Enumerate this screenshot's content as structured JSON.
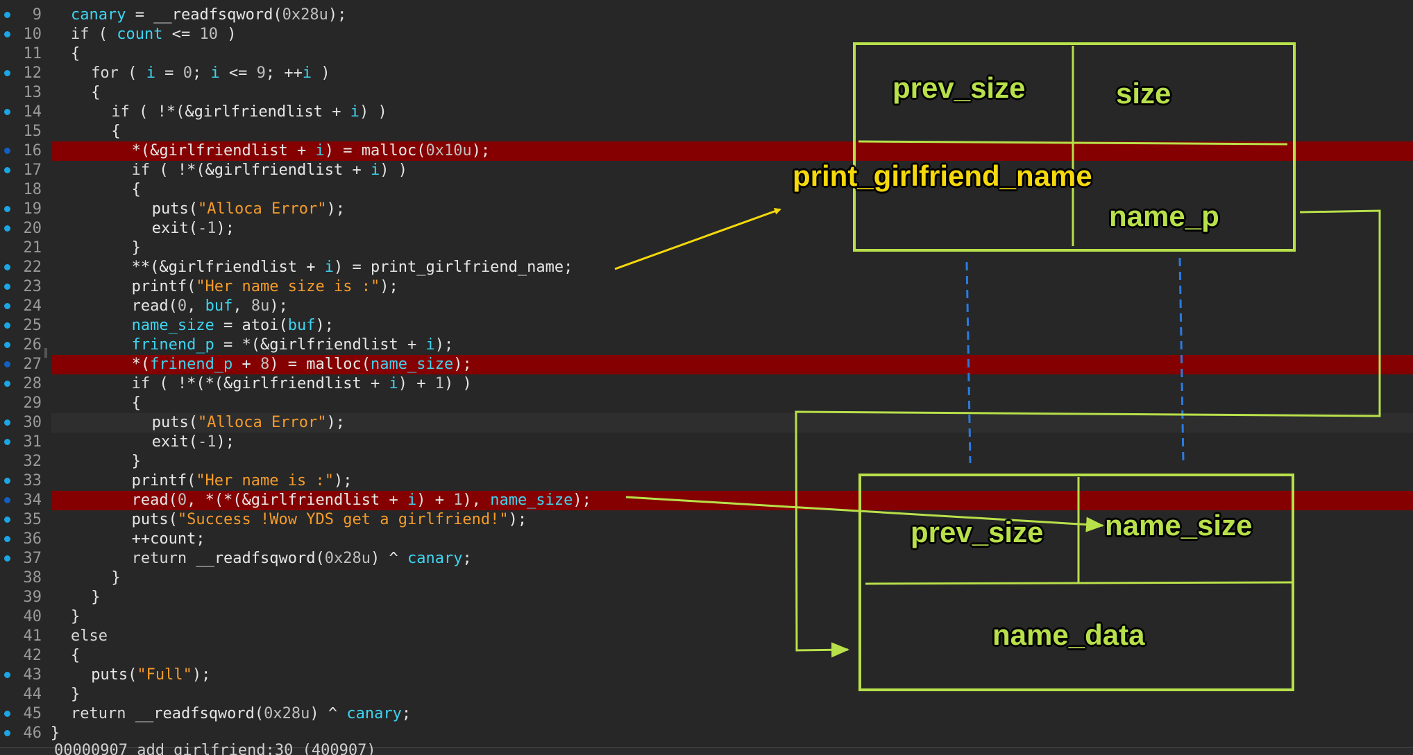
{
  "editor": {
    "lines": [
      {
        "n": "9",
        "dot": "light",
        "hl": false,
        "indent": 1,
        "tokens": [
          [
            "var",
            "canary"
          ],
          [
            "plain",
            " = __readfsqword("
          ],
          [
            "num",
            "0x28u"
          ],
          [
            "plain",
            ");"
          ]
        ]
      },
      {
        "n": "10",
        "dot": "light",
        "hl": false,
        "indent": 1,
        "tokens": [
          [
            "kw",
            "if"
          ],
          [
            "plain",
            " ( "
          ],
          [
            "var",
            "count"
          ],
          [
            "plain",
            " <= "
          ],
          [
            "num",
            "10"
          ],
          [
            "plain",
            " )"
          ]
        ]
      },
      {
        "n": "11",
        "dot": "none",
        "hl": false,
        "indent": 1,
        "tokens": [
          [
            "plain",
            "{"
          ]
        ]
      },
      {
        "n": "12",
        "dot": "light",
        "hl": false,
        "indent": 2,
        "tokens": [
          [
            "kw",
            "for"
          ],
          [
            "plain",
            " ( "
          ],
          [
            "var",
            "i"
          ],
          [
            "plain",
            " = "
          ],
          [
            "num",
            "0"
          ],
          [
            "plain",
            "; "
          ],
          [
            "var",
            "i"
          ],
          [
            "plain",
            " <= "
          ],
          [
            "num",
            "9"
          ],
          [
            "plain",
            "; ++"
          ],
          [
            "var",
            "i"
          ],
          [
            "plain",
            " )"
          ]
        ]
      },
      {
        "n": "13",
        "dot": "none",
        "hl": false,
        "indent": 2,
        "tokens": [
          [
            "plain",
            "{"
          ]
        ]
      },
      {
        "n": "14",
        "dot": "light",
        "hl": false,
        "indent": 3,
        "tokens": [
          [
            "kw",
            "if"
          ],
          [
            "plain",
            " ( !*(&girlfriendlist + "
          ],
          [
            "var",
            "i"
          ],
          [
            "plain",
            ") )"
          ]
        ]
      },
      {
        "n": "15",
        "dot": "none",
        "hl": false,
        "indent": 3,
        "tokens": [
          [
            "plain",
            "{"
          ]
        ]
      },
      {
        "n": "16",
        "dot": "dark",
        "hl": true,
        "indent": 4,
        "tokens": [
          [
            "plain",
            "*(&girlfriendlist + "
          ],
          [
            "var",
            "i"
          ],
          [
            "plain",
            ") = malloc("
          ],
          [
            "num",
            "0x10u"
          ],
          [
            "plain",
            ");"
          ]
        ]
      },
      {
        "n": "17",
        "dot": "light",
        "hl": false,
        "indent": 4,
        "tokens": [
          [
            "kw",
            "if"
          ],
          [
            "plain",
            " ( !*(&girlfriendlist + "
          ],
          [
            "var",
            "i"
          ],
          [
            "plain",
            ") )"
          ]
        ]
      },
      {
        "n": "18",
        "dot": "none",
        "hl": false,
        "indent": 4,
        "tokens": [
          [
            "plain",
            "{"
          ]
        ]
      },
      {
        "n": "19",
        "dot": "light",
        "hl": false,
        "indent": 5,
        "tokens": [
          [
            "plain",
            "puts("
          ],
          [
            "str",
            "\"Alloca Error\""
          ],
          [
            "plain",
            ");"
          ]
        ]
      },
      {
        "n": "20",
        "dot": "light",
        "hl": false,
        "indent": 5,
        "tokens": [
          [
            "plain",
            "exit("
          ],
          [
            "num",
            "-1"
          ],
          [
            "plain",
            ");"
          ]
        ]
      },
      {
        "n": "21",
        "dot": "none",
        "hl": false,
        "indent": 4,
        "tokens": [
          [
            "plain",
            "}"
          ]
        ]
      },
      {
        "n": "22",
        "dot": "light",
        "hl": false,
        "indent": 4,
        "tokens": [
          [
            "plain",
            "**(&girlfriendlist + "
          ],
          [
            "var",
            "i"
          ],
          [
            "plain",
            ") = print_girlfriend_name;"
          ]
        ]
      },
      {
        "n": "23",
        "dot": "light",
        "hl": false,
        "indent": 4,
        "tokens": [
          [
            "plain",
            "printf("
          ],
          [
            "str",
            "\"Her name size is :\""
          ],
          [
            "plain",
            ");"
          ]
        ]
      },
      {
        "n": "24",
        "dot": "light",
        "hl": false,
        "indent": 4,
        "tokens": [
          [
            "plain",
            "read("
          ],
          [
            "num",
            "0"
          ],
          [
            "plain",
            ", "
          ],
          [
            "var",
            "buf"
          ],
          [
            "plain",
            ", "
          ],
          [
            "num",
            "8u"
          ],
          [
            "plain",
            ");"
          ]
        ]
      },
      {
        "n": "25",
        "dot": "light",
        "hl": false,
        "indent": 4,
        "tokens": [
          [
            "var",
            "name_size"
          ],
          [
            "plain",
            " = atoi("
          ],
          [
            "var",
            "buf"
          ],
          [
            "plain",
            ");"
          ]
        ]
      },
      {
        "n": "26",
        "dot": "light",
        "hl": false,
        "indent": 4,
        "tokens": [
          [
            "var",
            "frinend_p"
          ],
          [
            "plain",
            " = *(&girlfriendlist + "
          ],
          [
            "var",
            "i"
          ],
          [
            "plain",
            ");"
          ]
        ]
      },
      {
        "n": "27",
        "dot": "dark",
        "hl": true,
        "indent": 4,
        "tokens": [
          [
            "plain",
            "*("
          ],
          [
            "var",
            "frinend_p"
          ],
          [
            "plain",
            " + "
          ],
          [
            "num",
            "8"
          ],
          [
            "plain",
            ") = malloc("
          ],
          [
            "var",
            "name_size"
          ],
          [
            "plain",
            ");"
          ]
        ]
      },
      {
        "n": "28",
        "dot": "light",
        "hl": false,
        "indent": 4,
        "tokens": [
          [
            "kw",
            "if"
          ],
          [
            "plain",
            " ( !*(*(&girlfriendlist + "
          ],
          [
            "var",
            "i"
          ],
          [
            "plain",
            ") + "
          ],
          [
            "num",
            "1"
          ],
          [
            "plain",
            ") )"
          ]
        ]
      },
      {
        "n": "29",
        "dot": "none",
        "hl": false,
        "indent": 4,
        "tokens": [
          [
            "plain",
            "{"
          ]
        ]
      },
      {
        "n": "30",
        "dot": "light",
        "hl": false,
        "indent": 5,
        "cur": true,
        "tokens": [
          [
            "plain",
            "puts("
          ],
          [
            "str",
            "\"Alloca Error\""
          ],
          [
            "plain",
            ");"
          ]
        ]
      },
      {
        "n": "31",
        "dot": "light",
        "hl": false,
        "indent": 5,
        "tokens": [
          [
            "plain",
            "exit("
          ],
          [
            "num",
            "-1"
          ],
          [
            "plain",
            ");"
          ]
        ]
      },
      {
        "n": "32",
        "dot": "none",
        "hl": false,
        "indent": 4,
        "tokens": [
          [
            "plain",
            "}"
          ]
        ]
      },
      {
        "n": "33",
        "dot": "light",
        "hl": false,
        "indent": 4,
        "tokens": [
          [
            "plain",
            "printf("
          ],
          [
            "str",
            "\"Her name is :\""
          ],
          [
            "plain",
            ");"
          ]
        ]
      },
      {
        "n": "34",
        "dot": "dark",
        "hl": true,
        "indent": 4,
        "tokens": [
          [
            "plain",
            "read("
          ],
          [
            "num",
            "0"
          ],
          [
            "plain",
            ", *(*(&girlfriendlist + "
          ],
          [
            "var",
            "i"
          ],
          [
            "plain",
            ") + "
          ],
          [
            "num",
            "1"
          ],
          [
            "plain",
            "), "
          ],
          [
            "var",
            "name_size"
          ],
          [
            "plain",
            ");"
          ]
        ]
      },
      {
        "n": "35",
        "dot": "light",
        "hl": false,
        "indent": 4,
        "tokens": [
          [
            "plain",
            "puts("
          ],
          [
            "str",
            "\"Success !Wow YDS get a girlfriend!\""
          ],
          [
            "plain",
            ");"
          ]
        ]
      },
      {
        "n": "36",
        "dot": "light",
        "hl": false,
        "indent": 4,
        "tokens": [
          [
            "plain",
            "++count;"
          ]
        ]
      },
      {
        "n": "37",
        "dot": "light",
        "hl": false,
        "indent": 4,
        "tokens": [
          [
            "kw",
            "return"
          ],
          [
            "plain",
            " __readfsqword("
          ],
          [
            "num",
            "0x28u"
          ],
          [
            "plain",
            ") ^ "
          ],
          [
            "var",
            "canary"
          ],
          [
            "plain",
            ";"
          ]
        ]
      },
      {
        "n": "38",
        "dot": "none",
        "hl": false,
        "indent": 3,
        "tokens": [
          [
            "plain",
            "}"
          ]
        ]
      },
      {
        "n": "39",
        "dot": "none",
        "hl": false,
        "indent": 2,
        "tokens": [
          [
            "plain",
            "}"
          ]
        ]
      },
      {
        "n": "40",
        "dot": "none",
        "hl": false,
        "indent": 1,
        "tokens": [
          [
            "plain",
            "}"
          ]
        ]
      },
      {
        "n": "41",
        "dot": "none",
        "hl": false,
        "indent": 1,
        "tokens": [
          [
            "kw",
            "else"
          ]
        ]
      },
      {
        "n": "42",
        "dot": "none",
        "hl": false,
        "indent": 1,
        "tokens": [
          [
            "plain",
            "{"
          ]
        ]
      },
      {
        "n": "43",
        "dot": "light",
        "hl": false,
        "indent": 2,
        "tokens": [
          [
            "plain",
            "puts("
          ],
          [
            "str",
            "\"Full\""
          ],
          [
            "plain",
            ");"
          ]
        ]
      },
      {
        "n": "44",
        "dot": "none",
        "hl": false,
        "indent": 1,
        "tokens": [
          [
            "plain",
            "}"
          ]
        ]
      },
      {
        "n": "45",
        "dot": "light",
        "hl": false,
        "indent": 1,
        "tokens": [
          [
            "kw",
            "return"
          ],
          [
            "plain",
            " __readfsqword("
          ],
          [
            "num",
            "0x28u"
          ],
          [
            "plain",
            ") ^ "
          ],
          [
            "var",
            "canary"
          ],
          [
            "plain",
            ";"
          ]
        ]
      },
      {
        "n": "46",
        "dot": "light",
        "hl": false,
        "indent": 0,
        "tokens": [
          [
            "plain",
            "}"
          ]
        ]
      }
    ]
  },
  "statusbar": {
    "text": "00000907 add_girlfriend:30 (400907)"
  },
  "diagram": {
    "chunk1": {
      "prev_size": "prev_size",
      "size": "size",
      "func_ptr": "print_girlfriend_name",
      "name_ptr": "name_p"
    },
    "chunk2": {
      "prev_size": "prev_size",
      "size": "name_size",
      "data": "name_data"
    },
    "colors": {
      "box": "#b8e04a",
      "arrow_yellow": "#f5d90a",
      "dashed": "#2a7be0",
      "highlight": "#850000",
      "var": "#3fd4f0",
      "string": "#f49b2b"
    }
  }
}
